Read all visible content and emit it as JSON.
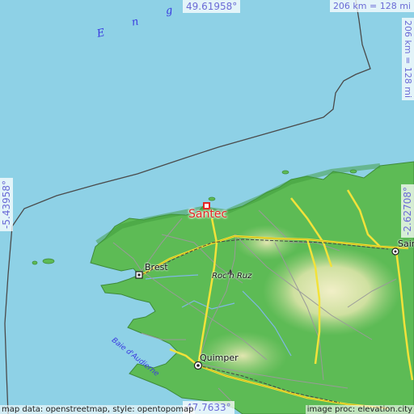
{
  "map": {
    "coords": {
      "top": "49.61958°",
      "bottom": "47.7633°",
      "left": "-5.43958°",
      "right": "-2.62708°"
    },
    "scale": {
      "horizontal": "206 km = 128 mi",
      "vertical": "206 km = 128 mi"
    },
    "sea_letters": [
      "E",
      "n",
      "g"
    ],
    "places": {
      "santec": "Santec",
      "brest": "Brest",
      "roch_ruz": "Roc'h Ruz",
      "quimper": "Quimper",
      "saint": "Sain"
    },
    "bay": "Baie d'Audierne",
    "credits": {
      "left": "map data: openstreetmap, style: opentopomap",
      "right": "image proc: elevation.city"
    },
    "colors": {
      "sea": "#8ed1e6",
      "lowland": "#5dbb55",
      "upland": "#dfe6b5",
      "marker": "#e42424",
      "label": "#6b6bd6"
    }
  }
}
